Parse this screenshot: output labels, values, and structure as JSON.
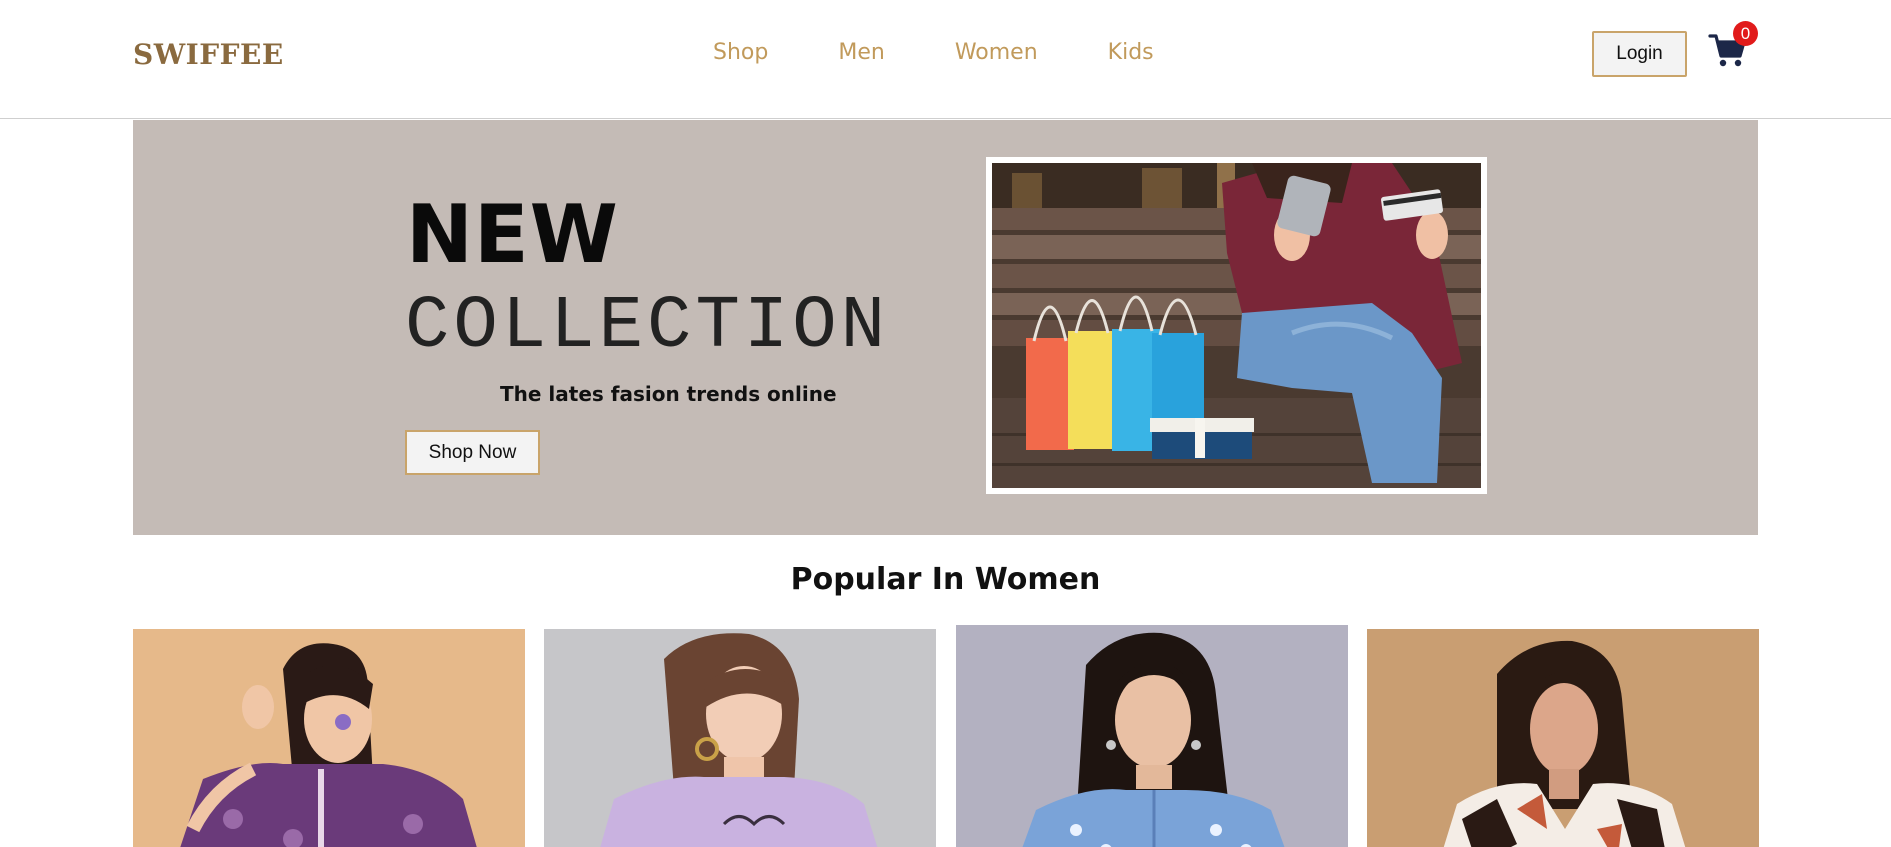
{
  "header": {
    "logo": "SWIFFEE",
    "nav": [
      {
        "label": "Shop"
      },
      {
        "label": "Men"
      },
      {
        "label": "Women"
      },
      {
        "label": "Kids"
      }
    ],
    "login_label": "Login",
    "cart_count": "0",
    "cart_icon": "cart-icon"
  },
  "hero": {
    "headline_1": "NEW",
    "headline_2": "COLLECTION",
    "tagline": "The lates fasion trends online",
    "cta_label": "Shop Now",
    "image": "woman-shopping-phone-card-photo"
  },
  "popular": {
    "title": "Popular In Women",
    "products": [
      {
        "image": "purple-paisley-kurta-photo"
      },
      {
        "image": "lavender-tshirt-photo"
      },
      {
        "image": "blue-print-kurta-photo"
      },
      {
        "image": "abstract-print-top-photo"
      }
    ]
  },
  "colors": {
    "brand": "#8a6a3f",
    "nav": "#c19a5b",
    "accent_border": "#c9a46a",
    "hero_bg": "#c4bbb6",
    "badge": "#e11b1b"
  }
}
